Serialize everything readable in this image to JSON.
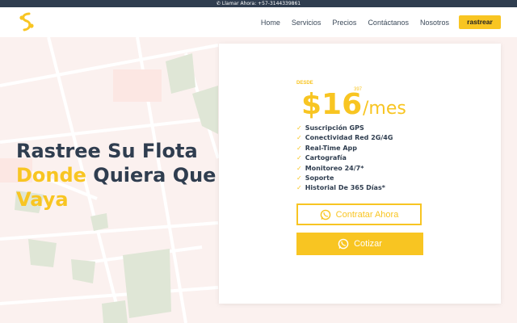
{
  "topbar": {
    "text": "Llamar Ahora: +57-3144339861"
  },
  "nav": {
    "items": [
      "Home",
      "Servicios",
      "Precios",
      "Contáctanos",
      "Nosotros"
    ],
    "cta": "rastrear"
  },
  "hero": {
    "line1": "Rastree Su Flota",
    "line2_accent": "Donde",
    "line2_rest": " Quiera Que",
    "line3": "Vaya"
  },
  "pricing": {
    "desde": "DESDE",
    "superscript": "397",
    "price": "$16",
    "period": "/mes",
    "features": [
      "Suscripción GPS",
      "Conectividad Red 2G/4G",
      "Real-Time App",
      "Cartografía",
      "Monitoreo 24/7*",
      "Soporte",
      "Historial De 365 Días*"
    ],
    "btn_outline": "Contratar Ahora",
    "btn_fill": "Cotizar"
  },
  "colors": {
    "accent": "#f8c522",
    "dark": "#2f3d4f",
    "topbar": "#2f3d4f"
  },
  "icons": [
    "phone-icon",
    "logo-icon",
    "whatsapp-icon",
    "check-icon"
  ]
}
